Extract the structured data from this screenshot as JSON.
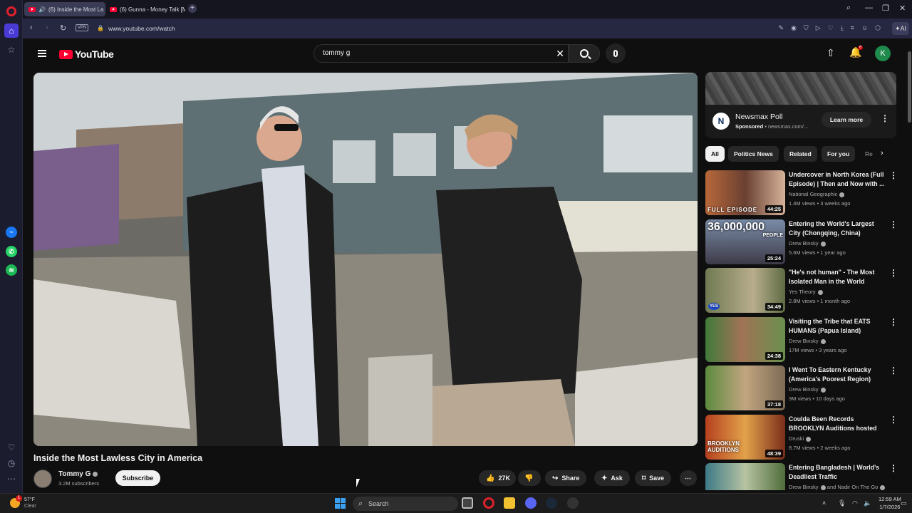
{
  "browser": {
    "tabs": [
      {
        "label": "(6) Inside the Most La",
        "active": true
      },
      {
        "label": "(6) Gunna - Money Talk [M",
        "active": false
      }
    ],
    "vpn_label": "VPN",
    "url": "www.youtube.com/watch",
    "ai_label": "AI"
  },
  "youtube": {
    "logo_text": "YouTube",
    "search": {
      "value": "tommy g",
      "placeholder": "Search"
    },
    "notifications_count": "6",
    "account_initial": "K",
    "video": {
      "title": "Inside the Most Lawless City in America",
      "channel": "Tommy G",
      "subscribers": "3.2M subscribers",
      "subscribe_label": "Subscribe",
      "likes": "27K",
      "share_label": "Share",
      "ask_label": "Ask",
      "save_label": "Save"
    },
    "ad": {
      "logo_letter": "N",
      "title": "Newsmax Poll",
      "sponsored": "Sponsored",
      "domain": "newsmax.com/...",
      "cta": "Learn more"
    },
    "chips": [
      "All",
      "Politics News",
      "Related",
      "For you",
      "Re"
    ],
    "recommendations": [
      {
        "title": "Undercover in North Korea (Full Episode) | Then and Now with ...",
        "channel": "National Geographic",
        "meta": "1.4M views • 3 weeks ago",
        "duration": "44:25",
        "overlay": "FULL EPISODE"
      },
      {
        "title": "Entering the World's Largest City (Chongqing, China)",
        "channel": "Drew Binsky",
        "meta": "5.6M views • 1 year ago",
        "duration": "25:24",
        "overlay": "36,000,000",
        "overlay2": "PEOPLE"
      },
      {
        "title": "\"He's not human\" - The Most Isolated Man in the World",
        "channel": "Yes Theory",
        "meta": "2.8M views • 1 month ago",
        "duration": "34:49",
        "overlay": "YES"
      },
      {
        "title": "Visiting the Tribe that EATS HUMANS (Papua Island)",
        "channel": "Drew Binsky",
        "meta": "17M views • 3 years ago",
        "duration": "24:38",
        "overlay": ""
      },
      {
        "title": "I Went To Eastern Kentucky (America's Poorest Region)",
        "channel": "Drew Binsky",
        "meta": "3M views • 10 days ago",
        "duration": "37:18",
        "overlay": ""
      },
      {
        "title": "Coulda Been Records BROOKLYN Auditions hosted b...",
        "channel": "Druski",
        "meta": "8.7M views • 2 weeks ago",
        "duration": "48:39",
        "overlay": "BROOKLYN",
        "overlay2": "AUDITIONS"
      },
      {
        "title": "Entering Bangladesh | World's Deadliest Traffic",
        "channel": "Drew Binsky",
        "channel_extra": "and Nadir On The Go",
        "meta": "",
        "duration": "",
        "overlay": ""
      }
    ]
  },
  "taskbar": {
    "weather_temp": "57°F",
    "weather_desc": "Clear",
    "weather_badge": "1",
    "search_label": "Search",
    "time": "12:59 AM",
    "date": "1/7/2026"
  },
  "colors": {
    "youtube_red": "#ff0033",
    "page_bg": "#0f0f0f",
    "opera_red": "#e0212c",
    "opera_rail": "#1b1c2e"
  }
}
